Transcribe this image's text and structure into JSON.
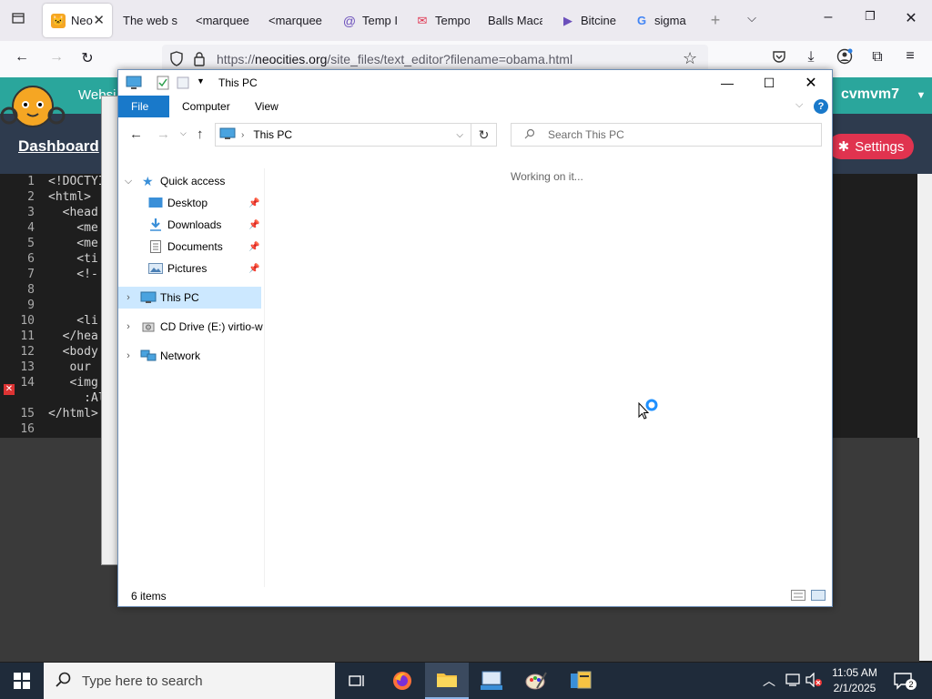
{
  "browser": {
    "tabs": [
      {
        "label": "Neo",
        "active": true
      },
      {
        "label": "The web sit",
        "active": false
      },
      {
        "label": "<marquee",
        "active": false
      },
      {
        "label": "<marquee",
        "active": false
      },
      {
        "label": "Temp I",
        "active": false
      },
      {
        "label": "Tempo",
        "active": false
      },
      {
        "label": "Balls Maca",
        "active": false
      },
      {
        "label": "Bitcine",
        "active": false
      },
      {
        "label": "sigma",
        "active": false
      }
    ],
    "url_prefix": "https://",
    "url_domain": "neocities.org",
    "url_path": "/site_files/text_editor?filename=obama.html"
  },
  "neocities": {
    "site_partial": "Websi",
    "username": "cvmvm7",
    "dashboard_label": "Dashboard",
    "settings_label": "Settings"
  },
  "editor": {
    "lines": [
      {
        "n": "1",
        "code": "<!DOCTYI"
      },
      {
        "n": "2",
        "code": "<html>"
      },
      {
        "n": "3",
        "code": "  <head"
      },
      {
        "n": "4",
        "code": "    <me"
      },
      {
        "n": "5",
        "code": "    <me"
      },
      {
        "n": "6",
        "code": "    <ti"
      },
      {
        "n": "7",
        "code": "    <!-"
      },
      {
        "n": "8",
        "code": ""
      },
      {
        "n": "9",
        "code": ""
      },
      {
        "n": "10",
        "code": "    <li"
      },
      {
        "n": "11",
        "code": "  </hea"
      },
      {
        "n": "12",
        "code": "  <body"
      },
      {
        "n": "13",
        "code": "   our"
      },
      {
        "n": "14",
        "code": "   <img"
      },
      {
        "n": "",
        "code": "     :Al"
      },
      {
        "n": "15",
        "code": "</html>"
      },
      {
        "n": "16",
        "code": ""
      }
    ]
  },
  "explorer": {
    "title": "This PC",
    "ribbon_tabs": [
      "File",
      "Computer",
      "View"
    ],
    "address": "This PC",
    "search_placeholder": "Search This PC",
    "nav": {
      "quick_access": "Quick access",
      "desktop": "Desktop",
      "downloads": "Downloads",
      "documents": "Documents",
      "pictures": "Pictures",
      "this_pc": "This PC",
      "cd_drive": "CD Drive (E:) virtio-w",
      "network": "Network"
    },
    "working_text": "Working on it...",
    "status": "6 items"
  },
  "taskbar": {
    "search_placeholder": "Type here to search",
    "time": "11:05 AM",
    "date": "2/1/2025",
    "notification_count": "2"
  },
  "colors": {
    "accent": "#1979ca",
    "selection": "#cce8ff",
    "taskbar": "#1f2b3a",
    "neocities_teal": "#2aa69c",
    "settings_red": "#e0334f"
  }
}
